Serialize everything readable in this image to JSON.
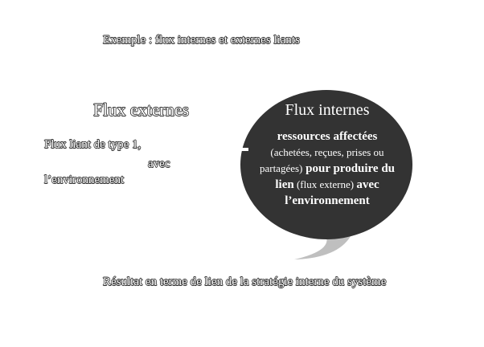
{
  "title": "Exemple : flux internes et externes liants",
  "external": {
    "heading": "Flux externes",
    "line1": "Flux liant de type 1,",
    "line2": "avec",
    "line3": "l’environnement"
  },
  "internal": {
    "heading": "Flux internes",
    "seg1": "ressources affectées",
    "seg2": "(achetées, reçues, prises ou partagées)",
    "seg3": " pour produire du lien",
    "seg4": " (flux externe) ",
    "seg5": "avec l’environnement"
  },
  "footer": "Résultat en terme de lien de la stratégie interne du système",
  "colors": {
    "bubble": "#333333",
    "tail": "#bfbfbf",
    "text_outline": "#2e2e2e"
  }
}
